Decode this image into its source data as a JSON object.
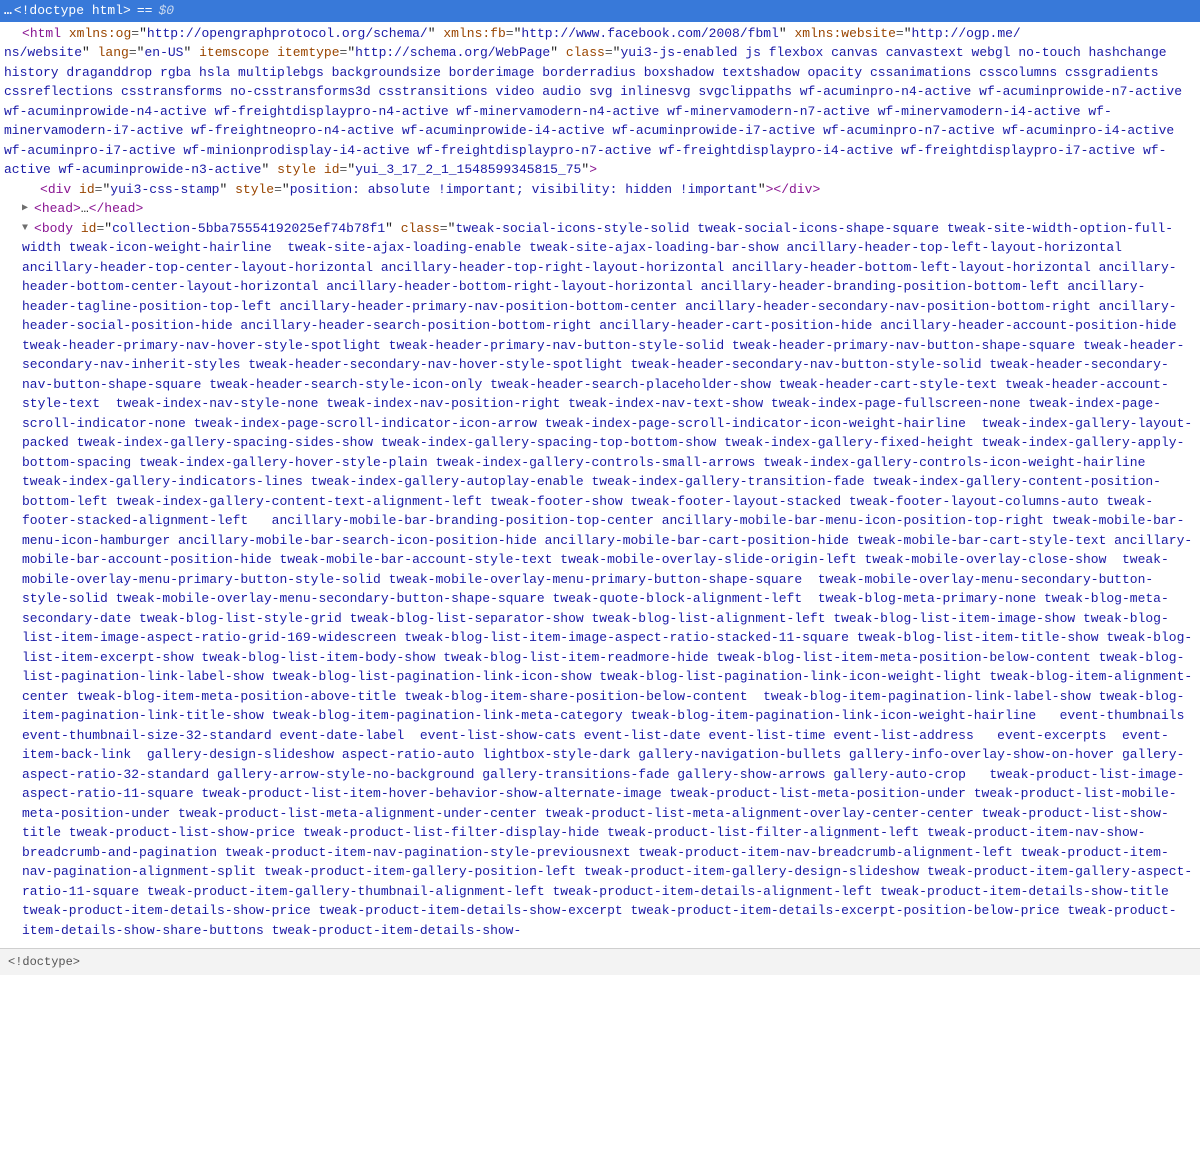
{
  "selected": {
    "prefix": "…",
    "doctype": "<!doctype html>",
    "eq": "==",
    "dollar": "$0"
  },
  "html_tag": {
    "xmlns_og": "http://opengraphprotocol.org/schema/",
    "xmlns_fb": "http://www.facebook.com/2008/fbml",
    "xmlns_website_part1": "http://ogp.me/",
    "xmlns_website_part2": "ns/website",
    "lang": "en-US",
    "itemscope": "itemscope",
    "itemtype": "http://schema.org/WebPage",
    "class": "yui3-js-enabled js flexbox canvas canvastext webgl no-touch hashchange history draganddrop rgba hsla multiplebgs backgroundsize borderimage borderradius boxshadow textshadow opacity cssanimations csscolumns cssgradients cssreflections csstransforms no-csstransforms3d csstransitions video audio svg inlinesvg svgclippaths wf-acuminpro-n4-active wf-acuminprowide-n7-active wf-acuminprowide-n4-active wf-freightdisplaypro-n4-active wf-minervamodern-n4-active wf-minervamodern-n7-active wf-minervamodern-i4-active wf-minervamodern-i7-active wf-freightneopro-n4-active wf-acuminprowide-i4-active wf-acuminprowide-i7-active wf-acuminpro-n7-active wf-acuminpro-i4-active wf-acuminpro-i7-active wf-minionprodisplay-i4-active wf-freightdisplaypro-n7-active wf-freightdisplaypro-i4-active wf-freightdisplaypro-i7-active wf-active wf-acuminprowide-n3-active",
    "html_style": "",
    "html_id": "yui_3_17_2_1_1548599345815_75"
  },
  "div_stamp": {
    "id": "yui3-css-stamp",
    "style": "position: absolute !important; visibility: hidden !important"
  },
  "head": {
    "open": "head",
    "dots": "…",
    "close": "head"
  },
  "body_tag": {
    "id": "collection-5bba75554192025ef74b78f1",
    "class": "tweak-social-icons-style-solid tweak-social-icons-shape-square tweak-site-width-option-full-width tweak-icon-weight-hairline  tweak-site-ajax-loading-enable tweak-site-ajax-loading-bar-show ancillary-header-top-left-layout-horizontal ancillary-header-top-center-layout-horizontal ancillary-header-top-right-layout-horizontal ancillary-header-bottom-left-layout-horizontal ancillary-header-bottom-center-layout-horizontal ancillary-header-bottom-right-layout-horizontal ancillary-header-branding-position-bottom-left ancillary-header-tagline-position-top-left ancillary-header-primary-nav-position-bottom-center ancillary-header-secondary-nav-position-bottom-right ancillary-header-social-position-hide ancillary-header-search-position-bottom-right ancillary-header-cart-position-hide ancillary-header-account-position-hide tweak-header-primary-nav-hover-style-spotlight tweak-header-primary-nav-button-style-solid tweak-header-primary-nav-button-shape-square tweak-header-secondary-nav-inherit-styles tweak-header-secondary-nav-hover-style-spotlight tweak-header-secondary-nav-button-style-solid tweak-header-secondary-nav-button-shape-square tweak-header-search-style-icon-only tweak-header-search-placeholder-show tweak-header-cart-style-text tweak-header-account-style-text  tweak-index-nav-style-none tweak-index-nav-position-right tweak-index-nav-text-show tweak-index-page-fullscreen-none tweak-index-page-scroll-indicator-none tweak-index-page-scroll-indicator-icon-arrow tweak-index-page-scroll-indicator-icon-weight-hairline  tweak-index-gallery-layout-packed tweak-index-gallery-spacing-sides-show tweak-index-gallery-spacing-top-bottom-show tweak-index-gallery-fixed-height tweak-index-gallery-apply-bottom-spacing tweak-index-gallery-hover-style-plain tweak-index-gallery-controls-small-arrows tweak-index-gallery-controls-icon-weight-hairline tweak-index-gallery-indicators-lines tweak-index-gallery-autoplay-enable tweak-index-gallery-transition-fade tweak-index-gallery-content-position-bottom-left tweak-index-gallery-content-text-alignment-left tweak-footer-show tweak-footer-layout-stacked tweak-footer-layout-columns-auto tweak-footer-stacked-alignment-left   ancillary-mobile-bar-branding-position-top-center ancillary-mobile-bar-menu-icon-position-top-right tweak-mobile-bar-menu-icon-hamburger ancillary-mobile-bar-search-icon-position-hide ancillary-mobile-bar-cart-position-hide tweak-mobile-bar-cart-style-text ancillary-mobile-bar-account-position-hide tweak-mobile-bar-account-style-text tweak-mobile-overlay-slide-origin-left tweak-mobile-overlay-close-show  tweak-mobile-overlay-menu-primary-button-style-solid tweak-mobile-overlay-menu-primary-button-shape-square  tweak-mobile-overlay-menu-secondary-button-style-solid tweak-mobile-overlay-menu-secondary-button-shape-square tweak-quote-block-alignment-left  tweak-blog-meta-primary-none tweak-blog-meta-secondary-date tweak-blog-list-style-grid tweak-blog-list-separator-show tweak-blog-list-alignment-left tweak-blog-list-item-image-show tweak-blog-list-item-image-aspect-ratio-grid-169-widescreen tweak-blog-list-item-image-aspect-ratio-stacked-11-square tweak-blog-list-item-title-show tweak-blog-list-item-excerpt-show tweak-blog-list-item-body-show tweak-blog-list-item-readmore-hide tweak-blog-list-item-meta-position-below-content tweak-blog-list-pagination-link-label-show tweak-blog-list-pagination-link-icon-show tweak-blog-list-pagination-link-icon-weight-light tweak-blog-item-alignment-center tweak-blog-item-meta-position-above-title tweak-blog-item-share-position-below-content  tweak-blog-item-pagination-link-label-show tweak-blog-item-pagination-link-title-show tweak-blog-item-pagination-link-meta-category tweak-blog-item-pagination-link-icon-weight-hairline   event-thumbnails event-thumbnail-size-32-standard event-date-label  event-list-show-cats event-list-date event-list-time event-list-address   event-excerpts  event-item-back-link  gallery-design-slideshow aspect-ratio-auto lightbox-style-dark gallery-navigation-bullets gallery-info-overlay-show-on-hover gallery-aspect-ratio-32-standard gallery-arrow-style-no-background gallery-transitions-fade gallery-show-arrows gallery-auto-crop   tweak-product-list-image-aspect-ratio-11-square tweak-product-list-item-hover-behavior-show-alternate-image tweak-product-list-meta-position-under tweak-product-list-mobile-meta-position-under tweak-product-list-meta-alignment-under-center tweak-product-list-meta-alignment-overlay-center-center tweak-product-list-show-title tweak-product-list-show-price tweak-product-list-filter-display-hide tweak-product-list-filter-alignment-left tweak-product-item-nav-show-breadcrumb-and-pagination tweak-product-item-nav-pagination-style-previousnext tweak-product-item-nav-breadcrumb-alignment-left tweak-product-item-nav-pagination-alignment-split tweak-product-item-gallery-position-left tweak-product-item-gallery-design-slideshow tweak-product-item-gallery-aspect-ratio-11-square tweak-product-item-gallery-thumbnail-alignment-left tweak-product-item-details-alignment-left tweak-product-item-details-show-title tweak-product-item-details-show-price tweak-product-item-details-show-excerpt tweak-product-item-details-excerpt-position-below-price tweak-product-item-details-show-share-buttons tweak-product-item-details-show-"
  },
  "breadcrumb": {
    "doctype": "<!doctype>"
  }
}
